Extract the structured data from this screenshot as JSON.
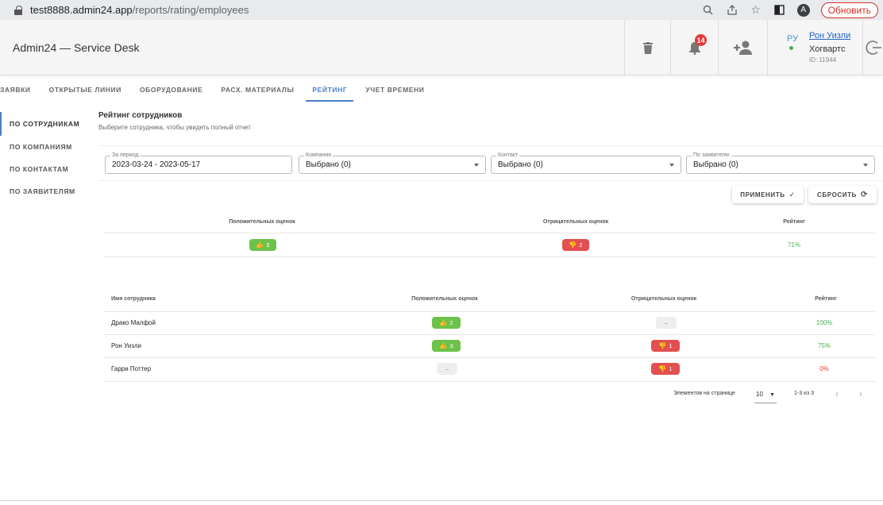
{
  "browser": {
    "url_host": "test8888.admin24.app",
    "url_path": "/reports/rating/employees",
    "avatar_letter": "A",
    "update_label": "Обновить"
  },
  "header": {
    "title": "Admin24 — Service Desk",
    "notifications_count": "14",
    "user": {
      "initials": "РУ",
      "name": "Рон Уизли",
      "company": "Хогвартс",
      "id": "ID: 11944"
    }
  },
  "tabs": [
    {
      "label": "ЗАЯВКИ"
    },
    {
      "label": "ОТКРЫТЫЕ ЛИНИИ"
    },
    {
      "label": "ОБОРУДОВАНИЕ"
    },
    {
      "label": "РАСХ. МАТЕРИАЛЫ"
    },
    {
      "label": "РЕЙТИНГ"
    },
    {
      "label": "УЧЕТ ВРЕМЕНИ"
    }
  ],
  "active_tab": "РЕЙТИНГ",
  "sidenav": [
    {
      "label": "ПО СОТРУДНИКАМ"
    },
    {
      "label": "ПО КОМПАНИЯМ"
    },
    {
      "label": "ПО КОНТАКТАМ"
    },
    {
      "label": "ПО ЗАЯВИТЕЛЯМ"
    }
  ],
  "main": {
    "title": "Рейтинг сотрудников",
    "subtitle": "Выберите сотрудника, чтобы увидеть полный отчет",
    "filters": {
      "period": {
        "label": "За период",
        "value": "2023-03-24 - 2023-05-17"
      },
      "company": {
        "label": "Компания",
        "value": "Выбрано (0)"
      },
      "contact": {
        "label": "Контакт",
        "value": "Выбрано (0)"
      },
      "applicant": {
        "label": "По заявителю",
        "value": "Выбрано (0)"
      }
    },
    "apply_label": "ПРИМЕНИТЬ",
    "reset_label": "СБРОСИТЬ",
    "summary": {
      "headers": {
        "positive": "Положительных оценок",
        "negative": "Отрицательных оценок",
        "rating": "Рейтинг"
      },
      "positive": "5",
      "negative": "2",
      "rating": "71%"
    },
    "employees": {
      "headers": {
        "name": "Имя сотрудника",
        "positive": "Положительных оценок",
        "negative": "Отрицательных оценок",
        "rating": "Рейтинг"
      },
      "rows": [
        {
          "name": "Драко Малфой",
          "positive": "2",
          "negative": "–",
          "rating": "100%"
        },
        {
          "name": "Рон Уизли",
          "positive": "3",
          "negative": "1",
          "rating": "75%"
        },
        {
          "name": "Гарри Поттер",
          "positive": "–",
          "negative": "1",
          "rating": "0%"
        }
      ]
    },
    "pagination": {
      "per_page_label": "Элементов на странице",
      "per_page_value": "10",
      "range": "1-3 из 3"
    }
  },
  "colors": {
    "accent": "#4a7fc9",
    "positive": "#6cc24a",
    "negative": "#e25050",
    "rating_green": "#4caf50",
    "rating_red": "#e53935"
  }
}
